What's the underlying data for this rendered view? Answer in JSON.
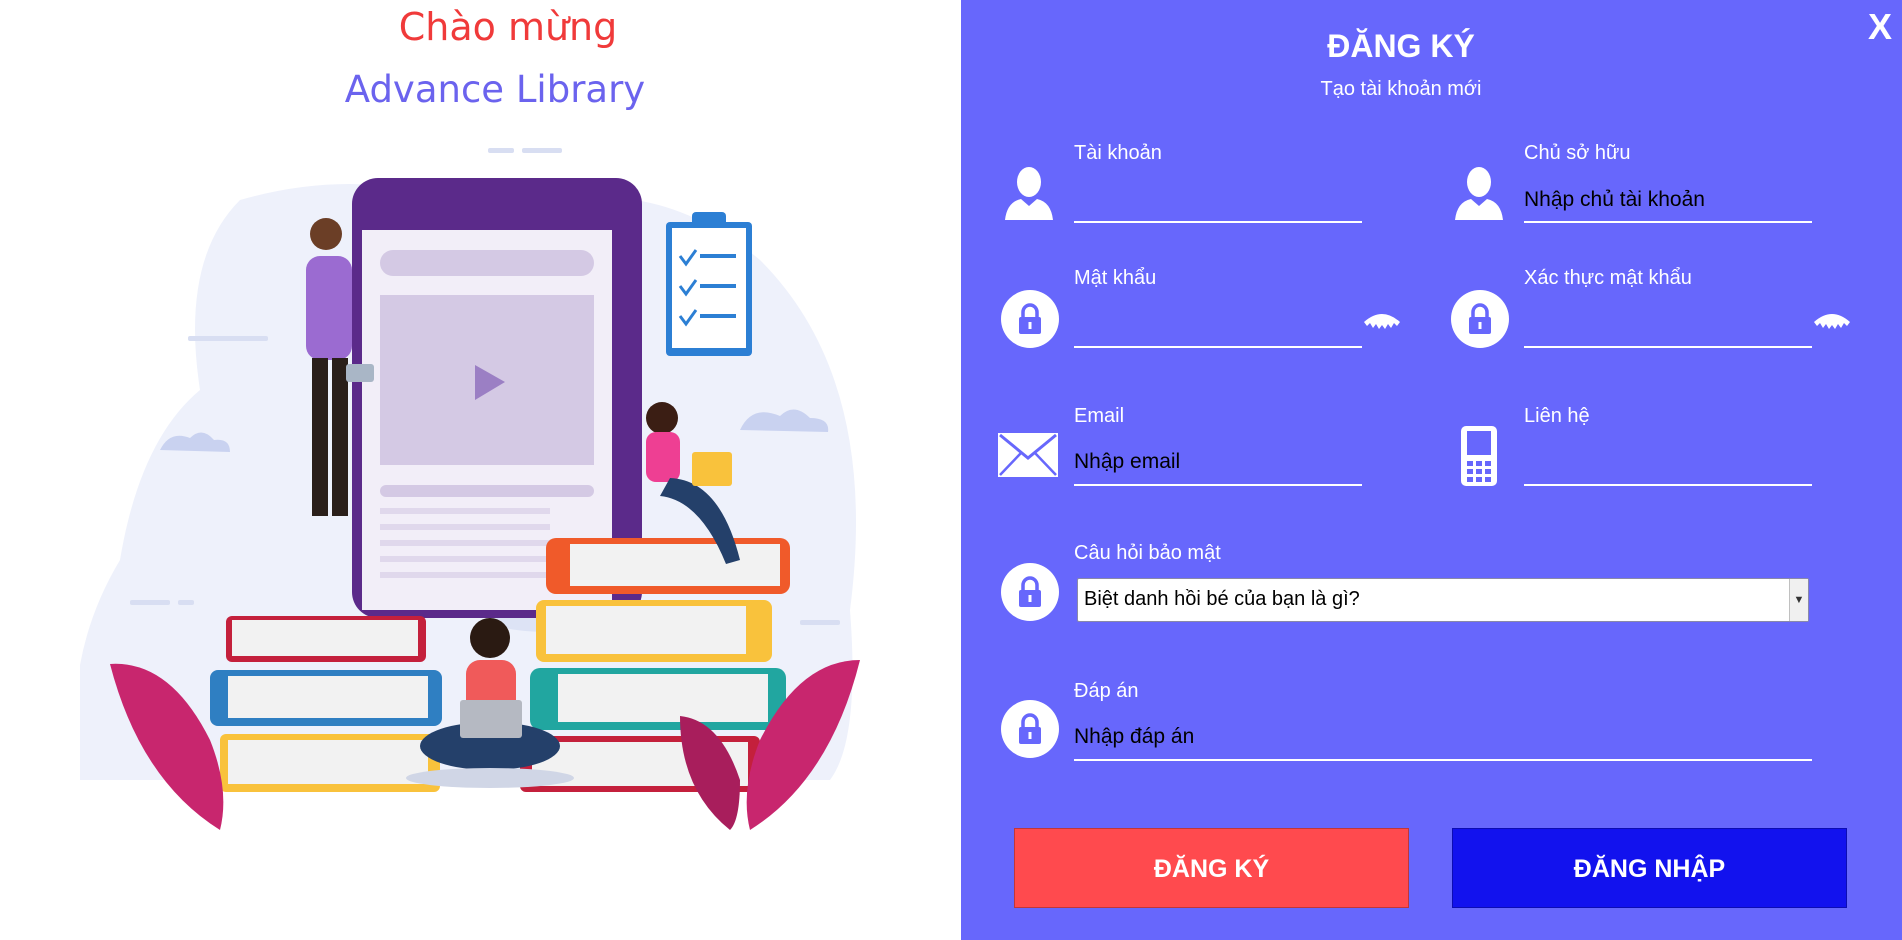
{
  "welcome": {
    "greeting": "Chào mừng",
    "app_name": "Advance Library"
  },
  "form": {
    "close_label": "X",
    "title": "ĐĂNG KÝ",
    "subtitle": "Tạo tài khoản mới",
    "account": {
      "label": "Tài khoản",
      "value": ""
    },
    "owner": {
      "label": "Chủ sở hữu",
      "value": "Nhập chủ tài khoản"
    },
    "password": {
      "label": "Mật khẩu",
      "value": ""
    },
    "confirm_password": {
      "label": "Xác thực mật khẩu",
      "value": ""
    },
    "email": {
      "label": "Email",
      "value": "Nhập email"
    },
    "contact": {
      "label": "Liên hệ",
      "value": ""
    },
    "security_question": {
      "label": "Câu hỏi bảo mật",
      "selected": "Biệt danh hồi bé của bạn là gì?"
    },
    "answer": {
      "label": "Đáp án",
      "value": "Nhập đáp án"
    },
    "register_button": "ĐĂNG KÝ",
    "login_button": "ĐĂNG NHẬP"
  },
  "colors": {
    "panel_bg": "#6767fc",
    "register_btn": "#ff4a4e",
    "login_btn": "#1212ee",
    "greeting": "#f03a3a",
    "app_name": "#6b63ee"
  },
  "icons": [
    "user-icon",
    "lock-icon",
    "eye-icon",
    "mail-icon",
    "phone-icon",
    "close-icon"
  ]
}
